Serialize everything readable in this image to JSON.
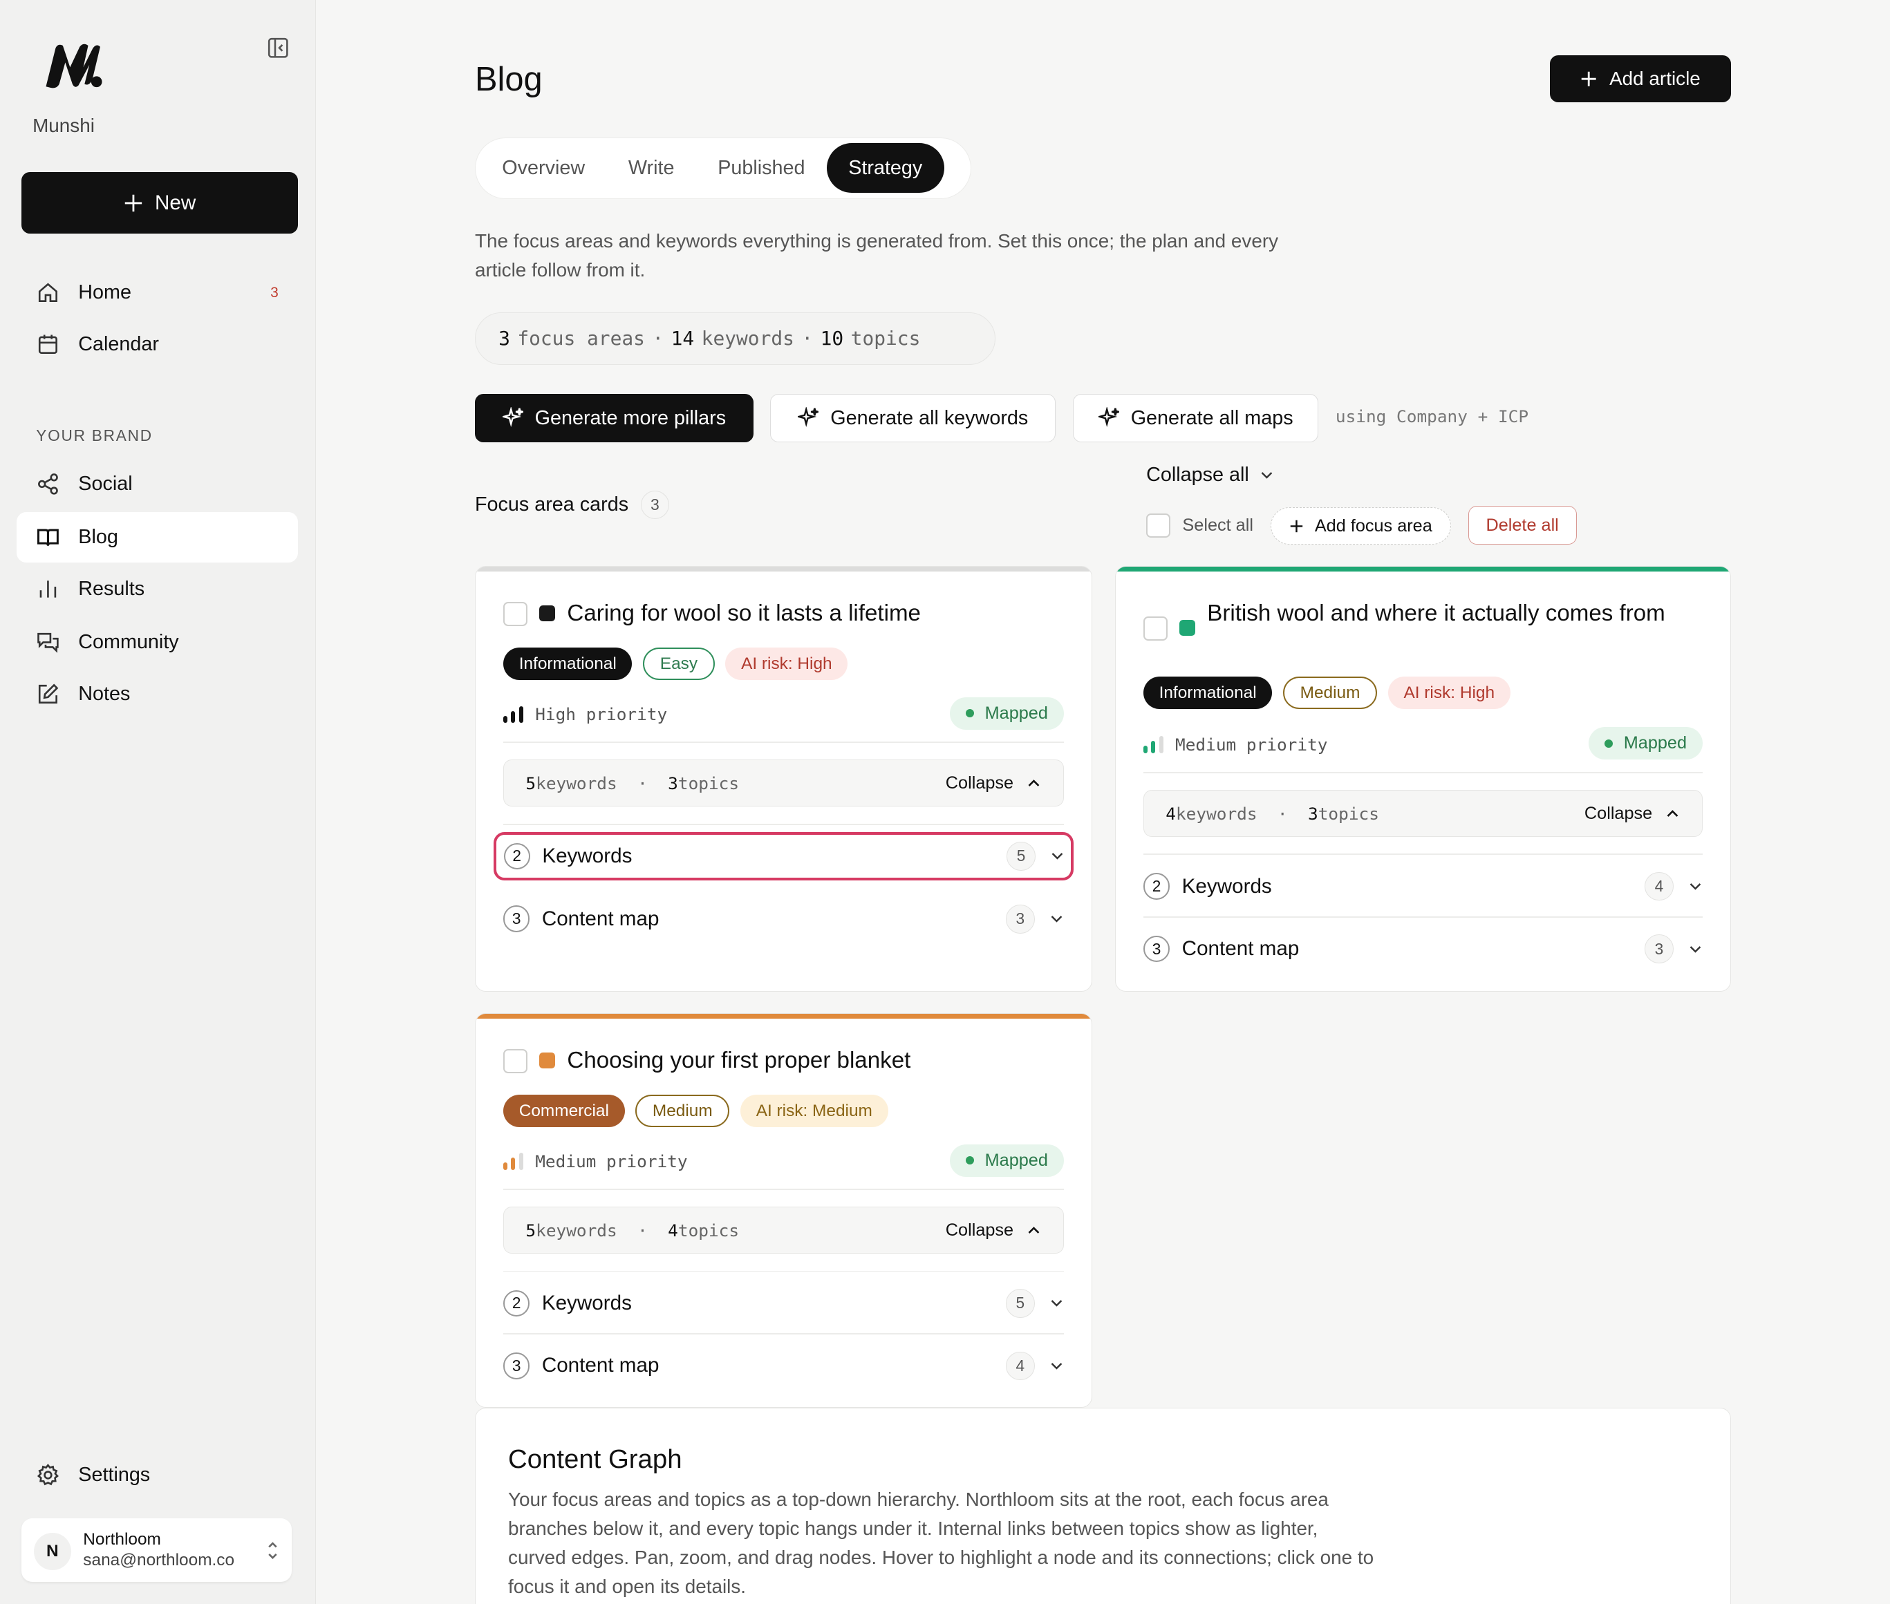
{
  "sidebar": {
    "brand": "Munshi",
    "new_label": "New",
    "nav_top": [
      {
        "label": "Home",
        "icon": "home-icon",
        "badge": "3"
      },
      {
        "label": "Calendar",
        "icon": "calendar-icon"
      }
    ],
    "section_label": "YOUR BRAND",
    "nav_brand": [
      {
        "label": "Social",
        "icon": "share-icon"
      },
      {
        "label": "Blog",
        "icon": "book-icon",
        "active": true
      },
      {
        "label": "Results",
        "icon": "bar-chart-icon"
      },
      {
        "label": "Community",
        "icon": "chat-icon"
      },
      {
        "label": "Notes",
        "icon": "edit-icon"
      }
    ],
    "settings_label": "Settings",
    "user": {
      "initial": "N",
      "name": "Northloom",
      "email": "sana@northloom.co"
    }
  },
  "header": {
    "title": "Blog",
    "add_article_label": "Add article"
  },
  "tabs": [
    {
      "label": "Overview"
    },
    {
      "label": "Write"
    },
    {
      "label": "Published"
    },
    {
      "label": "Strategy",
      "active": true
    }
  ],
  "description": "The focus areas and keywords everything is generated from. Set this once; the plan and every article follow from it.",
  "stats": {
    "focus_areas": "3",
    "focus_label": "focus areas",
    "keywords": "14",
    "keywords_label": "keywords",
    "topics": "10",
    "topics_label": "topics",
    "sep": "·"
  },
  "actions": {
    "generate_pillars": "Generate more pillars",
    "generate_keywords": "Generate all keywords",
    "generate_maps": "Generate all maps",
    "using_note": "using Company + ICP"
  },
  "toolbar": {
    "collapse_all": "Collapse all",
    "focus_cards_label": "Focus area cards",
    "focus_cards_count": "3",
    "select_all": "Select all",
    "add_focus_area": "Add focus area",
    "delete_all": "Delete all"
  },
  "cards": [
    {
      "title": "Caring for wool so it lasts a lifetime",
      "dot_color": "#1a1a1a",
      "bar_color": "#dcdcdb",
      "tags": [
        "Informational",
        "Easy",
        "AI risk: High"
      ],
      "priority": "High priority",
      "status": "Mapped",
      "keywords_count": "5",
      "keywords_word": "keywords",
      "topics_count": "3",
      "topics_word": "topics",
      "collapse_label": "Collapse",
      "sections": [
        {
          "num": "2",
          "label": "Keywords",
          "count": "5"
        },
        {
          "num": "3",
          "label": "Content map",
          "count": "3"
        }
      ]
    },
    {
      "title": "British wool and where it actually comes from",
      "dot_color": "#1fa774",
      "bar_color": "#1fa774",
      "tags": [
        "Informational",
        "Medium",
        "AI risk: High"
      ],
      "priority": "Medium priority",
      "status": "Mapped",
      "keywords_count": "4",
      "keywords_word": "keywords",
      "topics_count": "3",
      "topics_word": "topics",
      "collapse_label": "Collapse",
      "sections": [
        {
          "num": "2",
          "label": "Keywords",
          "count": "4"
        },
        {
          "num": "3",
          "label": "Content map",
          "count": "3"
        }
      ]
    },
    {
      "title": "Choosing your first proper blanket",
      "dot_color": "#e08a3c",
      "bar_color": "#e08a3c",
      "tags": [
        "Commercial",
        "Medium",
        "AI risk: Medium"
      ],
      "priority": "Medium priority",
      "status": "Mapped",
      "keywords_count": "5",
      "keywords_word": "keywords",
      "topics_count": "4",
      "topics_word": "topics",
      "collapse_label": "Collapse",
      "sections": [
        {
          "num": "2",
          "label": "Keywords",
          "count": "5"
        },
        {
          "num": "3",
          "label": "Content map",
          "count": "4"
        }
      ]
    }
  ],
  "content_graph": {
    "title": "Content Graph",
    "description": "Your focus areas and topics as a top-down hierarchy. Northloom sits at the root, each focus area branches below it, and every topic hangs under it. Internal links between topics show as lighter, curved edges. Pan, zoom, and drag nodes. Hover to highlight a node and its connections; click one to focus it and open its details."
  }
}
